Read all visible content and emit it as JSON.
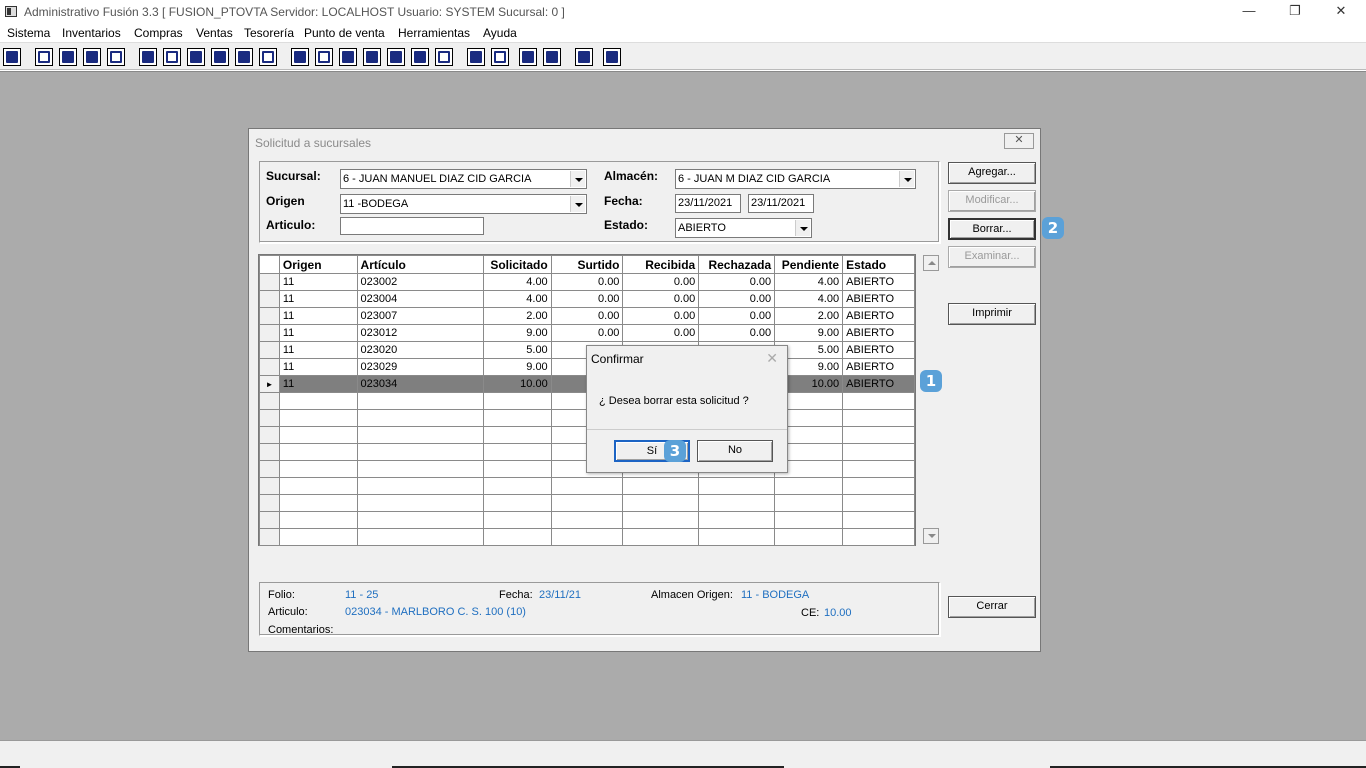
{
  "window": {
    "title": "Administrativo Fusión 3.3 [ FUSION_PTOVTA   Servidor: LOCALHOST   Usuario: SYSTEM     Sucursal: 0 ]",
    "min": "—",
    "restore": "❐",
    "close": "✕"
  },
  "menu": [
    "Sistema",
    "Inventarios",
    "Compras",
    "Ventas",
    "Tesorería",
    "Punto de venta",
    "Herramientas",
    "Ayuda"
  ],
  "dialog": {
    "title": "Solicitud a sucursales",
    "close": "✕",
    "filters": {
      "sucursal_label": "Sucursal:",
      "sucursal_value": "6 - JUAN MANUEL DIAZ CID GARCIA",
      "almacen_label": "Almacén:",
      "almacen_value": "6 - JUAN M DIAZ CID GARCIA",
      "origen_label": "Origen",
      "origen_value": "11  -BODEGA",
      "fecha_label": "Fecha:",
      "fecha_from": "23/11/2021",
      "fecha_to": "23/11/2021",
      "articulo_label": "Articulo:",
      "articulo_value": "",
      "estado_label": "Estado:",
      "estado_value": "ABIERTO"
    },
    "buttons": {
      "agregar": "Agregar...",
      "modificar": "Modificar...",
      "borrar": "Borrar...",
      "examinar": "Examinar...",
      "imprimir": "Imprimir",
      "cerrar": "Cerrar"
    },
    "grid": {
      "columns": [
        "Origen",
        "Artículo",
        "Solicitado",
        "Surtido",
        "Recibida",
        "Rechazada",
        "Pendiente",
        "Estado"
      ],
      "rows": [
        [
          "11",
          "023002",
          "4.00",
          "0.00",
          "0.00",
          "0.00",
          "4.00",
          "ABIERTO"
        ],
        [
          "11",
          "023004",
          "4.00",
          "0.00",
          "0.00",
          "0.00",
          "4.00",
          "ABIERTO"
        ],
        [
          "11",
          "023007",
          "2.00",
          "0.00",
          "0.00",
          "0.00",
          "2.00",
          "ABIERTO"
        ],
        [
          "11",
          "023012",
          "9.00",
          "0.00",
          "0.00",
          "0.00",
          "9.00",
          "ABIERTO"
        ],
        [
          "11",
          "023020",
          "5.00",
          "",
          "",
          "",
          "5.00",
          "ABIERTO"
        ],
        [
          "11",
          "023029",
          "9.00",
          "",
          "",
          "",
          "9.00",
          "ABIERTO"
        ],
        [
          "11",
          "023034",
          "10.00",
          "",
          "",
          "",
          "10.00",
          "ABIERTO"
        ]
      ],
      "selected_row_marker": "►"
    },
    "info": {
      "folio_label": "Folio:",
      "folio_value": "11 - 25",
      "fecha_label": "Fecha:",
      "fecha_value": "23/11/21",
      "almacen_label": "Almacen Origen:",
      "almacen_value": "11 - BODEGA",
      "articulo_label": "Articulo:",
      "articulo_value": "023034 - MARLBORO C. S. 100 (10)",
      "ce_label": "CE:",
      "ce_value": "10.00",
      "comentarios_label": "Comentarios:"
    }
  },
  "confirm": {
    "title": "Confirmar",
    "close": "✕",
    "message": "¿ Desea borrar esta solicitud ?",
    "yes": "Sí",
    "no": "No"
  },
  "badges": {
    "one": "1",
    "two": "2",
    "three": "3"
  },
  "colors": {
    "workspace": "#ababab",
    "selected_row": "#7f7f7f",
    "badge": "#5ba1d8",
    "info_value": "#1f6fc0"
  }
}
